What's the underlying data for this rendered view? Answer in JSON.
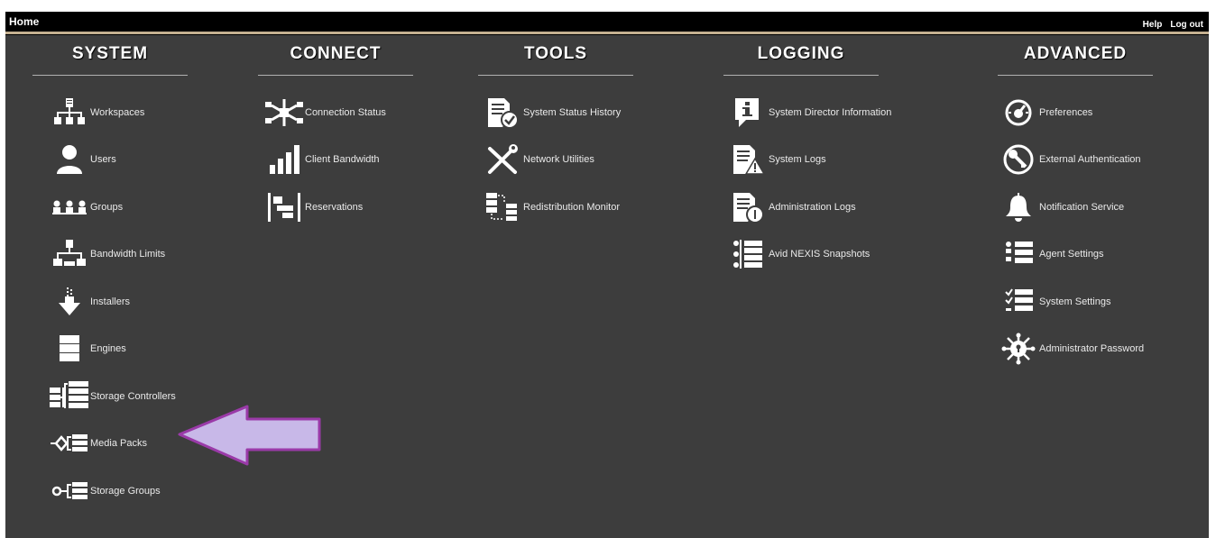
{
  "topbar": {
    "title": "Home",
    "help": "Help",
    "logout": "Log out"
  },
  "columns": [
    {
      "header": "SYSTEM",
      "items": [
        {
          "label": "Workspaces",
          "icon": "workspaces-icon"
        },
        {
          "label": "Users",
          "icon": "user-icon"
        },
        {
          "label": "Groups",
          "icon": "groups-icon"
        },
        {
          "label": "Bandwidth Limits",
          "icon": "bandwidth-limits-icon"
        },
        {
          "label": "Installers",
          "icon": "installers-icon"
        },
        {
          "label": "Engines",
          "icon": "engines-icon"
        },
        {
          "label": "Storage Controllers",
          "icon": "storage-controllers-icon"
        },
        {
          "label": "Media Packs",
          "icon": "media-packs-icon"
        },
        {
          "label": "Storage Groups",
          "icon": "storage-groups-icon"
        }
      ]
    },
    {
      "header": "CONNECT",
      "items": [
        {
          "label": "Connection Status",
          "icon": "connection-status-icon"
        },
        {
          "label": "Client Bandwidth",
          "icon": "signal-bars-icon"
        },
        {
          "label": "Reservations",
          "icon": "reservations-icon"
        }
      ]
    },
    {
      "header": "TOOLS",
      "items": [
        {
          "label": "System Status History",
          "icon": "status-history-icon"
        },
        {
          "label": "Network Utilities",
          "icon": "tools-icon"
        },
        {
          "label": "Redistribution Monitor",
          "icon": "redistribution-icon"
        }
      ]
    },
    {
      "header": "LOGGING",
      "items": [
        {
          "label": "System Director Information",
          "icon": "info-icon"
        },
        {
          "label": "System Logs",
          "icon": "system-logs-icon"
        },
        {
          "label": "Administration Logs",
          "icon": "admin-logs-icon"
        },
        {
          "label": "Avid NEXIS Snapshots",
          "icon": "snapshots-icon"
        }
      ]
    },
    {
      "header": "ADVANCED",
      "items": [
        {
          "label": "Preferences",
          "icon": "gauge-icon"
        },
        {
          "label": "External Authentication",
          "icon": "key-icon"
        },
        {
          "label": "Notification Service",
          "icon": "bell-icon"
        },
        {
          "label": "Agent Settings",
          "icon": "agent-settings-icon"
        },
        {
          "label": "System Settings",
          "icon": "system-settings-icon"
        },
        {
          "label": "Administrator Password",
          "icon": "admin-password-icon"
        }
      ]
    }
  ],
  "annotation": {
    "arrow_color": "#c8b8e8",
    "arrow_stroke": "#9a3aa8"
  }
}
